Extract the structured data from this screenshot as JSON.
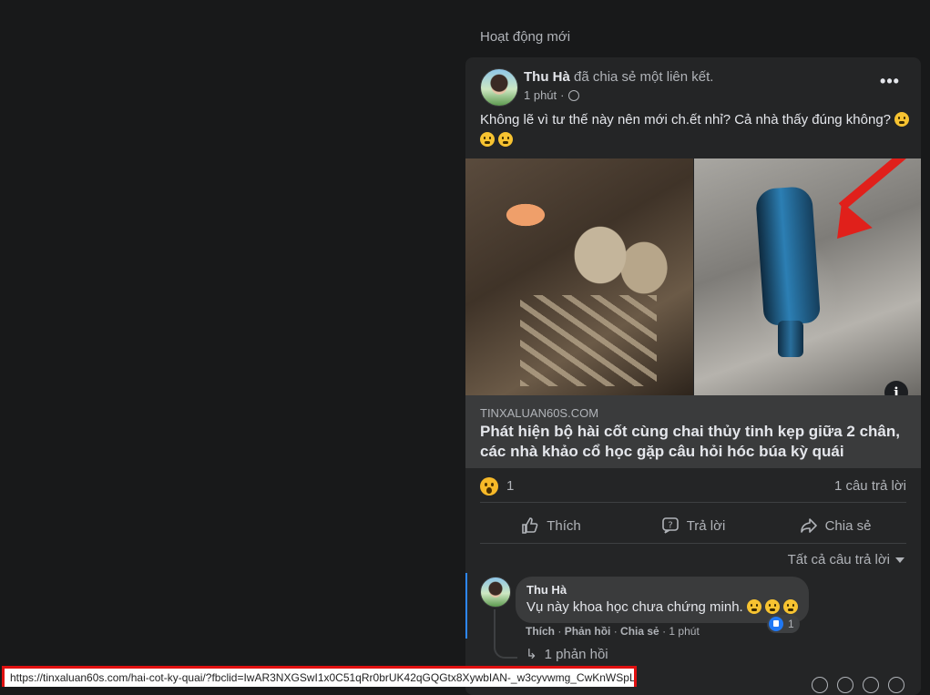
{
  "section_title": "Hoạt động mới",
  "post": {
    "author": "Thu Hà",
    "action": "đã chia sẻ một liên kết.",
    "time": "1 phút",
    "time_separator": "·",
    "more_label": "•••",
    "text": "Không lẽ vì tư thế này nên mới ch.ết nhỉ? Cả nhà thấy đúng không?",
    "info_label": "i",
    "link": {
      "domain": "TINXALUAN60S.COM",
      "title": "Phát hiện bộ hài cốt cùng chai thủy tinh kẹp giữa 2 chân, các nhà khảo cổ học gặp câu hỏi hóc búa kỳ quái"
    },
    "reactions": {
      "count": "1",
      "replies": "1 câu trả lời"
    },
    "actions": {
      "like": "Thích",
      "reply": "Trả lời",
      "share": "Chia sẻ"
    },
    "all_replies": "Tất cả câu trả lời"
  },
  "comment": {
    "author": "Thu Hà",
    "text": "Vụ này khoa học chưa chứng minh.",
    "like_count": "1",
    "actions": {
      "like": "Thích",
      "reply": "Phản hồi",
      "share": "Chia sẻ",
      "time": "1 phút",
      "dot": "·"
    },
    "replies": "1 phản hồi"
  },
  "status_url": "https://tinxaluan60s.com/hai-cot-ky-quai/?fbclid=IwAR3NXGSwI1x0C51qRr0brUK42qGQGtx8XywbIAN-_w3cyvwmg_CwKnWSpLc",
  "colors": {
    "background": "#18191a",
    "card": "#242526",
    "accent": "#2d88ff",
    "highlight_border": "#e01010"
  }
}
